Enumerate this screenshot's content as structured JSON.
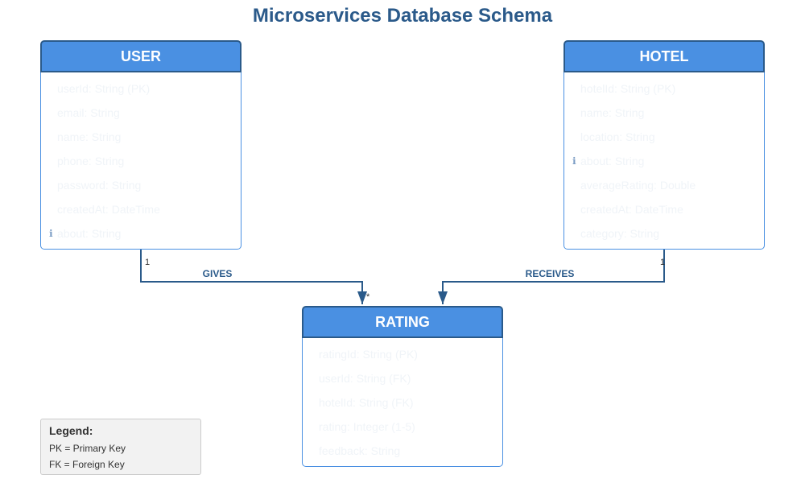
{
  "title": "Microservices Database Schema",
  "entities": {
    "user": {
      "name": "USER",
      "attributes": [
        "userId: String (PK)",
        "email: String",
        "name: String",
        "phone: String",
        "password: String",
        "createdAt: DateTime",
        "about: String"
      ]
    },
    "hotel": {
      "name": "HOTEL",
      "attributes": [
        "hotelId: String (PK)",
        "name: String",
        "location: String",
        "about: String",
        "averageRating: Double",
        "createdAt: DateTime",
        "category: String"
      ]
    },
    "rating": {
      "name": "RATING",
      "attributes": [
        "ratingId: String (PK)",
        "userId: String (FK)",
        "hotelId: String (FK)",
        "rating: Integer (1-5)",
        "feedback: String"
      ]
    }
  },
  "relationships": {
    "gives": {
      "label": "GIVES",
      "from_mult": "1",
      "to_mult": "*"
    },
    "receives": {
      "label": "RECEIVES",
      "from_mult": "1"
    }
  },
  "info_marker": "ℹ",
  "legend": {
    "title": "Legend:",
    "items": [
      "PK = Primary Key",
      "FK = Foreign Key"
    ]
  },
  "colors": {
    "header_fill": "#4a90e2",
    "header_border": "#2a5a8a",
    "title": "#2b5a8a",
    "connector": "#2a5a8a"
  }
}
